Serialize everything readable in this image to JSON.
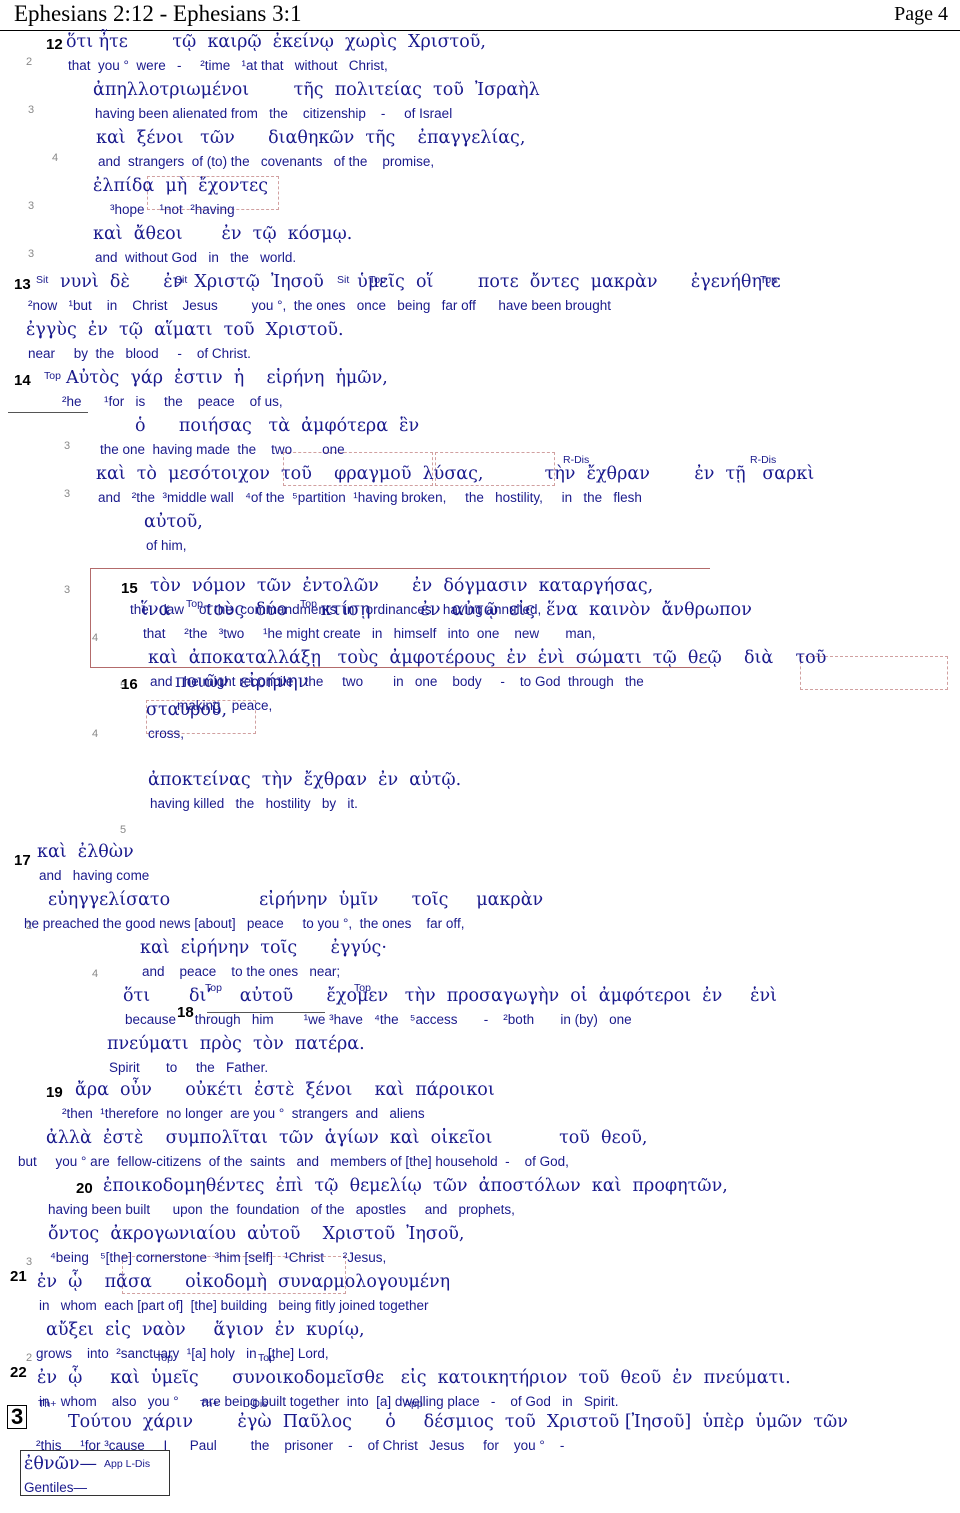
{
  "header": {
    "title": "Ephesians 2:12 - Ephesians 3:1",
    "page": "Page 4"
  },
  "verses": [
    {
      "num": "12",
      "level": "2"
    },
    {
      "num": "13",
      "level": ""
    },
    {
      "num": "14",
      "level": ""
    },
    {
      "num": "15",
      "level": "3"
    },
    {
      "num": "16",
      "level": "4"
    },
    {
      "num": "17",
      "level": ""
    },
    {
      "num": "18",
      "level": "4"
    },
    {
      "num": "19",
      "level": "2"
    },
    {
      "num": "20",
      "level": "2"
    },
    {
      "num": "21",
      "level": ""
    },
    {
      "num": "22",
      "level": "2"
    },
    {
      "num": "3",
      "level": ""
    }
  ],
  "lines": [
    {
      "id": "l1",
      "level": "2",
      "greek": "ὅτι ἦτε        τῷ  καιρῷ  ἐκείνῳ  χωρὶς  Χριστοῦ,",
      "english": "that  you °  were   -     ²time   ¹at that   without   Christ,"
    },
    {
      "id": "l2",
      "level": "3",
      "greek": "ἀπηλλοτριωμένοι        τῆς  πολιτείας  τοῦ  Ἰσραὴλ",
      "english": "having been alienated from   the    citizenship    -     of Israel"
    },
    {
      "id": "l3",
      "level": "4",
      "greek": "καὶ  ξένοι   τῶν      διαθηκῶν  τῆς    ἐπαγγελίας,",
      "english": "and  strangers  of (to) the   covenants   of the    promise,"
    },
    {
      "id": "l4",
      "level": "3",
      "greek": "ἐλπίδα  μὴ  ἔχοντες",
      "english": "³hope    ¹not  ²having"
    },
    {
      "id": "l5",
      "level": "3",
      "greek": "καὶ  ἄθεοι       ἐν  τῷ  κόσμῳ.",
      "english": "and  without God   in   the   world."
    },
    {
      "id": "l6",
      "level": "",
      "greek": "νυνὶ  δὲ      ἐν  Χριστῷ  Ἰησοῦ      ὑμεῖς  οἵ        ποτε  ὄντες  μακρὰν      ἐγενήθητε",
      "english": "²now   ¹but    in    Christ    Jesus         you °,  the ones   once   being   far off      have been brought"
    },
    {
      "id": "l7",
      "level": "",
      "greek": "ἐγγὺς  ἐν  τῷ  αἵματι  τοῦ  Χριστοῦ.",
      "english": "near     by  the   blood     -    of Christ."
    },
    {
      "id": "l8",
      "level": "",
      "greek": "Αὐτὸς  γάρ  ἐστιν  ἡ    εἰρήνη  ἡμῶν,",
      "english": "²he      ¹for   is     the    peace    of us,"
    },
    {
      "id": "l9",
      "level": "3",
      "greek": "ὁ      ποιήσας   τὰ  ἀμφότερα  ἓν",
      "english": "the one  having made  the    two        one"
    },
    {
      "id": "l10",
      "level": "3",
      "greek": "καὶ  τὸ  μεσότοιχον  τοῦ    φραγμοῦ  λύσας,           τὴν  ἔχθραν        ἐν  τῇ   σαρκὶ",
      "english": "and   ²the  ³middle wall   ⁴of the  ⁵partition  ¹having broken,     the   hostility,     in   the   flesh"
    },
    {
      "id": "l11",
      "level": "",
      "greek": "αὐτοῦ,",
      "english": "of him,"
    },
    {
      "id": "l12",
      "level": "3",
      "greek": "τὸν  νόμον  τῶν  ἐντολῶν      ἐν  δόγμασιν  καταργήσας,",
      "english": "the    law    of the  commandments  in   ordinances   having annulled,"
    },
    {
      "id": "l13",
      "level": "4",
      "greek": "ἵνα      τοὺς  δύο      κτίσῃ         ἐν  αὐτῷ  εἰς  ἕνα  καινὸν  ἄνθρωπον",
      "english": "that     ²the   ³two     ¹he might create   in   himself   into  one    new       man,"
    },
    {
      "id": "l14",
      "level": "5",
      "greek": "ποιῶν  εἰρήνην",
      "english": "making   peace,"
    },
    {
      "id": "l15",
      "level": "4",
      "greek": "καὶ  ἀποκαταλλάξῃ   τοὺς  ἀμφοτέρους  ἐν  ἑνὶ  σώματι  τῷ  θεῷ    διὰ    τοῦ",
      "english": "and   he might reconcile   the     two        in   one    body     -    to God  through   the"
    },
    {
      "id": "l16",
      "level": "",
      "greek": "σταυροῦ,",
      "english": "cross,"
    },
    {
      "id": "l17",
      "level": "5",
      "greek": "ἀποκτείνας  τὴν  ἔχθραν  ἐν  αὐτῷ.",
      "english": "having killed   the   hostility   by   it."
    },
    {
      "id": "l18",
      "level": "",
      "greek": "καὶ  ἐλθὼν",
      "english": "and   having come"
    },
    {
      "id": "l19",
      "level": "2",
      "greek": "εὐηγγελίσατο                εἰρήνην  ὑμῖν      τοῖς     μακρὰν",
      "english": "he preached the good news [about]   peace     to you °,  the ones    far off,"
    },
    {
      "id": "l20",
      "level": "4",
      "greek": "καὶ  εἰρήνην  τοῖς      ἐγγύς·",
      "english": "and    peace    to the ones   near;"
    },
    {
      "id": "l21",
      "level": "",
      "greek": "ὅτι       δι’     αὐτοῦ      ἔχομεν   τὴν  προσαγωγὴν  οἱ  ἀμφότεροι  ἐν     ἑνὶ",
      "english": "because     through   him        ¹we ³have   ⁴the   ⁵access       -    ²both       in (by)   one"
    },
    {
      "id": "l22",
      "level": "",
      "greek": "πνεύματι  πρὸς  τὸν  πατέρα.",
      "english": "Spirit       to     the   Father."
    },
    {
      "id": "l23",
      "level": "",
      "greek": "ἄρα  οὖν      οὐκέτι  ἐστὲ  ξένοι    καὶ  πάροικοι",
      "english": "²then  ¹therefore  no longer  are you °  strangers  and   aliens"
    },
    {
      "id": "l24",
      "level": "",
      "greek": "ἀλλὰ  ἐστὲ    συμπολῖται  τῶν  ἁγίων  καὶ  οἰκεῖοι            τοῦ  θεοῦ,",
      "english": "but     you ° are  fellow-citizens  of the  saints   and   members of [the] household  -    of God,"
    },
    {
      "id": "l25",
      "level": "",
      "greek": "ἐποικοδομηθέντες  ἐπὶ  τῷ  θεμελίῳ  τῶν  ἀποστόλων  καὶ  προφητῶν,",
      "english": "having been built      upon  the  foundation   of the   apostles     and   prophets,"
    },
    {
      "id": "l26",
      "level": "3",
      "greek": "ὄντος  ἀκρογωνιαίου  αὐτοῦ    Χριστοῦ  Ἰησοῦ,",
      "english": "⁴being   ⁵[the] cornerstone  ³him [self]   ¹Christ     ²Jesus,"
    },
    {
      "id": "l27",
      "level": "",
      "greek": "ἐν  ᾧ    πᾶσα      οἰκοδομὴ  συναρμολογουμένη",
      "english": "in   whom  each [part of]  [the] building   being fitly joined together"
    },
    {
      "id": "l28",
      "level": "2",
      "greek": "αὔξει  εἰς  ναὸν     ἅγιον  ἐν  κυρίῳ,",
      "english": "grows    into  ²sanctuary  ¹[a] holy   in   [the] Lord,"
    },
    {
      "id": "l29",
      "level": "",
      "greek": "ἐν  ᾧ     καὶ  ὑμεῖς      συνοικοδομεῖσθε   εἰς  κατοικητήριον  τοῦ  θεοῦ  ἐν  πνεύματι.",
      "english": "in   whom    also   you °      are being built together  into  [a] dwelling place   -    of God   in   Spirit."
    },
    {
      "id": "l30",
      "level": "",
      "greek": "Τούτου  χάριν        ἐγὼ  Παῦλος      ὁ     δέσμιος  τοῦ  Χριστοῦ [Ἰησοῦ]  ὑπὲρ  ὑμῶν  τῶν",
      "english": "²this     ¹for ³cause     I      Paul         the    prisoner    -    of Christ   Jesus     for    you °    -"
    },
    {
      "id": "l31",
      "level": "",
      "greek": "ἐθνῶν—",
      "english": "Gentiles—"
    }
  ],
  "tags": {
    "sit": "Sit",
    "top": "Top",
    "rdis": "R-Dis",
    "thplus": "Th+",
    "ldis": "L-Dis",
    "app": "App",
    "appldis": "App L-Dis"
  },
  "chapter_marker": "3"
}
